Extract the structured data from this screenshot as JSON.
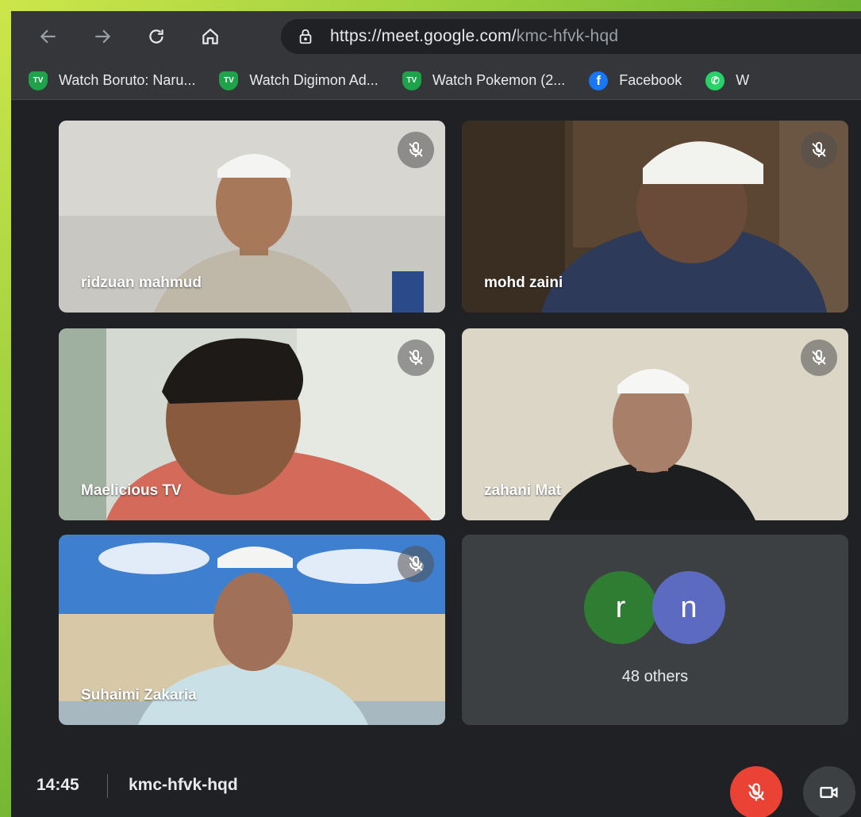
{
  "browser": {
    "url_domain": "https://meet.google.com/",
    "url_path": "kmc-hfvk-hqd",
    "bookmarks": [
      {
        "icon": "tv-icon",
        "label": "Watch Boruto: Naru..."
      },
      {
        "icon": "tv-icon",
        "label": "Watch Digimon Ad..."
      },
      {
        "icon": "tv-icon",
        "label": "Watch Pokemon (2..."
      },
      {
        "icon": "facebook-icon",
        "label": "Facebook"
      },
      {
        "icon": "whatsapp-icon",
        "label": "W"
      }
    ]
  },
  "participants": [
    {
      "name": "ridzuan mahmud",
      "muted": true
    },
    {
      "name": "mohd zaini",
      "muted": true
    },
    {
      "name": "Maelicious TV",
      "muted": true
    },
    {
      "name": "zahani Mat",
      "muted": true
    },
    {
      "name": "Suhaimi Zakaria",
      "muted": true
    }
  ],
  "others": {
    "avatars": [
      {
        "letter": "r",
        "color": "#2e7d32"
      },
      {
        "letter": "n",
        "color": "#5c6bc0"
      }
    ],
    "label": "48 others"
  },
  "bottom_bar": {
    "time": "14:45",
    "meeting_code": "kmc-hfvk-hqd"
  },
  "colors": {
    "mic_off_active": "#ea4335",
    "background": "#202124"
  }
}
